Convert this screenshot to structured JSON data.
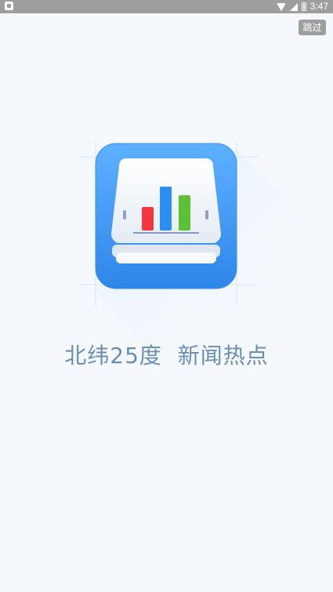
{
  "status_bar": {
    "time": "3:47",
    "icons": [
      "app-notification-icon",
      "wifi-icon",
      "signal-icon",
      "battery-icon"
    ]
  },
  "skip_button": {
    "label": "跳过"
  },
  "logo": {
    "icon_name": "bar-chart-app-icon",
    "colors": {
      "frame": "#3d95f3",
      "frame_light": "#5eb0ff",
      "card": "#eef2f8",
      "bar_red": "#f2383e",
      "bar_blue": "#2b8ff2",
      "bar_green": "#5bc236"
    }
  },
  "tagline": {
    "text": "北纬25度  新闻热点"
  }
}
